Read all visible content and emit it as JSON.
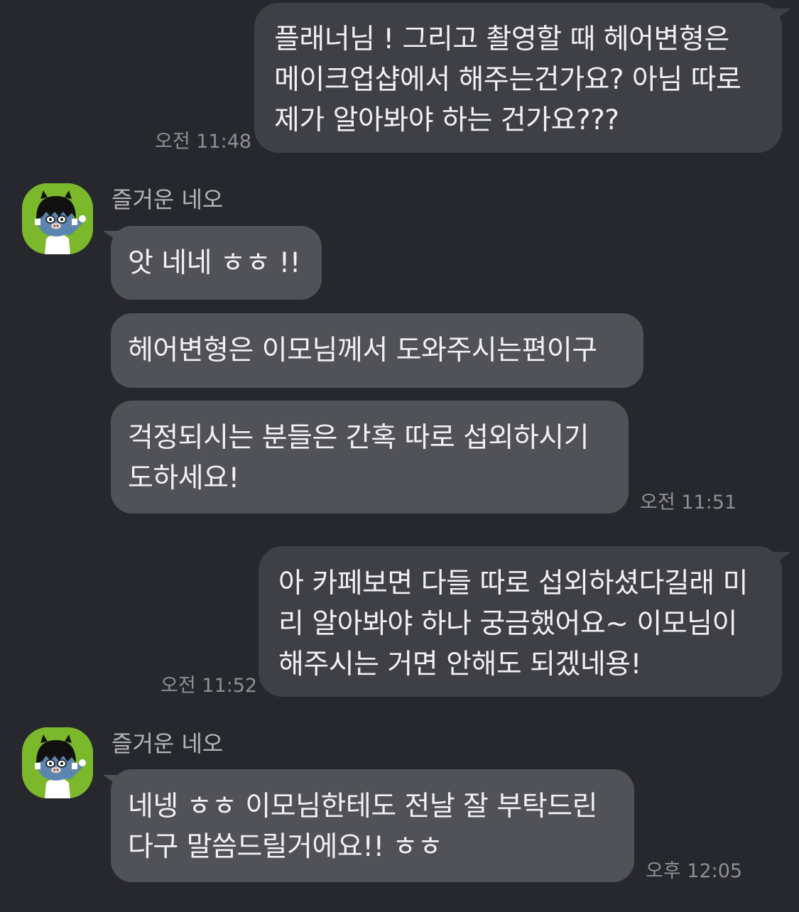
{
  "colors": {
    "background": "#27282d",
    "my_bubble": "#3e4046",
    "their_bubble": "#505257",
    "text": "#f1f1f2",
    "meta_text": "#8e9095",
    "avatar_bg": "#7bb82c"
  },
  "messages": [
    {
      "side": "me",
      "text": "플래너님 ! 그리고 촬영할 때 헤어변형은\n메이크업샵에서 해주는건가요? 아님 따로\n제가 알아봐야 하는 건가요???",
      "time": "오전 11:48"
    },
    {
      "side": "them",
      "sender": "즐거운 네오",
      "avatar_icon": "neo-avatar-icon",
      "texts": [
        "앗 네네 ㅎㅎ !!",
        "헤어변형은 이모님께서 도와주시는편이구",
        "걱정되시는 분들은 간혹 따로 섭외하시기\n도하세요!"
      ],
      "time": "오전 11:51"
    },
    {
      "side": "me",
      "text": "아 카페보면 다들 따로 섭외하셨다길래 미\n리 알아봐야 하나 궁금했어요~ 이모님이\n해주시는 거면 안해도 되겠네용!",
      "time": "오전 11:52"
    },
    {
      "side": "them",
      "sender": "즐거운 네오",
      "avatar_icon": "neo-avatar-icon",
      "texts": [
        "네넹 ㅎㅎ 이모님한테도 전날 잘 부탁드린\n다구 말씀드릴거에요!! ㅎㅎ"
      ],
      "time": "오후 12:05"
    }
  ]
}
